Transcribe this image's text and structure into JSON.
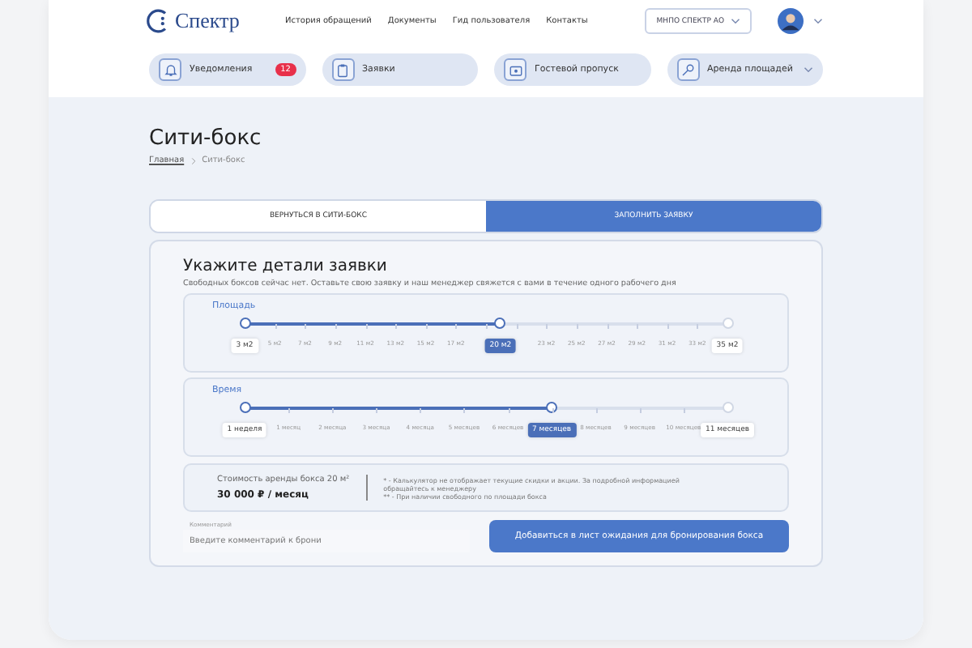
{
  "logo": {
    "text": "Спектр"
  },
  "nav": [
    "История обращений",
    "Документы",
    "Гид пользователя",
    "Контакты"
  ],
  "org_select": {
    "value": "МНПО СПЕКТР АО"
  },
  "quick_nav": [
    {
      "label": "Уведомления",
      "kind": "bell",
      "badge": "12",
      "dropdown": false
    },
    {
      "label": "Заявки",
      "kind": "clipboard",
      "dropdown": false
    },
    {
      "label": "Гостевой пропуск",
      "kind": "pass",
      "dropdown": false
    },
    {
      "label": "Аренда площадей",
      "kind": "key",
      "dropdown": true
    }
  ],
  "page_title": "Сити-бокс",
  "breadcrumbs": [
    {
      "label": "Главная",
      "link": true
    },
    {
      "label": "Сити-бокс",
      "link": false
    }
  ],
  "tabs": [
    {
      "label": "ВЕРНУТЬСЯ В СИТИ-БОКС",
      "selected": false
    },
    {
      "label": "ЗАПОЛНИТЬ ЗАЯВКУ",
      "selected": true
    }
  ],
  "form": {
    "title": "Укажите детали заявки",
    "subtitle": "Свободных боксов сейчас нет. Оставьте свою заявку и наш менеджер свяжется с вами в течение одного рабочего дня",
    "sliders": [
      {
        "label": "Площадь",
        "level": 0.53,
        "min_label": "3 м2",
        "max_label": "35 м2",
        "value": "20 м2",
        "ticks": [
          {
            "kind": "labeled",
            "label": "5 м2"
          },
          {
            "kind": "labeled",
            "label": "7 м2"
          },
          {
            "kind": "labeled",
            "label": "9 м2"
          },
          {
            "kind": "labeled",
            "label": "11 м2"
          },
          {
            "kind": "labeled",
            "label": "13 м2"
          },
          {
            "kind": "labeled",
            "label": "15 м2"
          },
          {
            "kind": "labeled",
            "label": "17 м2"
          },
          {
            "kind": "bare"
          },
          {
            "kind": "bare"
          },
          {
            "kind": "labeled",
            "label": "23 м2"
          },
          {
            "kind": "labeled",
            "label": "25 м2"
          },
          {
            "kind": "labeled",
            "label": "27 м2"
          },
          {
            "kind": "labeled",
            "label": "29 м2"
          },
          {
            "kind": "labeled",
            "label": "31 м2"
          },
          {
            "kind": "labeled",
            "label": "33 м2"
          }
        ]
      },
      {
        "label": "Время",
        "level": 0.636,
        "min_label": "1 неделя",
        "max_label": "11 месяцев",
        "value": "7 месяцев",
        "ticks": [
          {
            "kind": "labeled",
            "label": "1 месяц"
          },
          {
            "kind": "labeled",
            "label": "2 месяца"
          },
          {
            "kind": "labeled",
            "label": "3 месяца"
          },
          {
            "kind": "labeled",
            "label": "4 месяца"
          },
          {
            "kind": "labeled",
            "label": "5 месяцев"
          },
          {
            "kind": "labeled",
            "label": "6 месяцев"
          },
          {
            "kind": "bare"
          },
          {
            "kind": "labeled",
            "label": "8 месяцев"
          },
          {
            "kind": "labeled",
            "label": "9 месяцев"
          },
          {
            "kind": "labeled",
            "label": "10 месяцев"
          }
        ]
      }
    ],
    "cost": {
      "label": "Стоимость аренды бокса 20 м²",
      "value": "30 000 ₽ / месяц"
    },
    "notes": [
      "* - Калькулятор не отображает текущие скидки и акции. За подробной информацией обращайтесь к менеджеру",
      "** - При наличии свободного по площади бокса"
    ],
    "comment": {
      "label": "Комментарий",
      "placeholder": "Введите комментарий к брони"
    },
    "submit": "Добавиться в лист ожидания для бронирования бокса"
  }
}
